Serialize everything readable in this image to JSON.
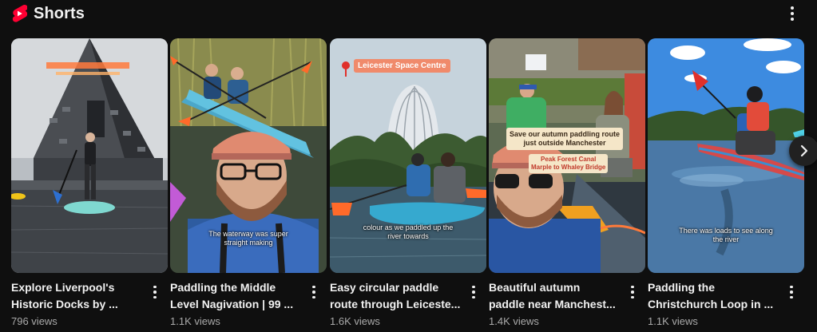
{
  "section": {
    "title": "Shorts",
    "logo_icon": "youtube-shorts-icon",
    "more_icon": "more-vert-icon",
    "brand_color": "#ff0033"
  },
  "shorts": [
    {
      "title_line1": "Explore Liverpool's",
      "title_line2": "Historic Docks by ...",
      "views": "796 views",
      "overlay_text": "",
      "tags": []
    },
    {
      "title_line1": "Paddling the Middle",
      "title_line2": "Level Nagivation | 99 ...",
      "views": "1.1K views",
      "overlay_text": "The waterway was super straight making",
      "tags": []
    },
    {
      "title_line1": "Easy circular paddle",
      "title_line2": "route through Leiceste...",
      "views": "1.6K views",
      "overlay_text": "colour as we paddled up the river towards",
      "tags": [
        "Leicester Space Centre"
      ]
    },
    {
      "title_line1": "Beautiful autumn",
      "title_line2": "paddle near Manchest...",
      "views": "1.4K views",
      "overlay_text": "",
      "tags": [
        "Save our autumn paddling route",
        "just outside Manchester",
        "Peak Forest Canal",
        "Marple to Whaley Bridge"
      ]
    },
    {
      "title_line1": "Paddling the",
      "title_line2": "Christchurch Loop in ...",
      "views": "1.1K views",
      "overlay_text": "There was loads to see along the river",
      "tags": []
    }
  ],
  "navigation": {
    "next_icon": "chevron-right-icon"
  }
}
